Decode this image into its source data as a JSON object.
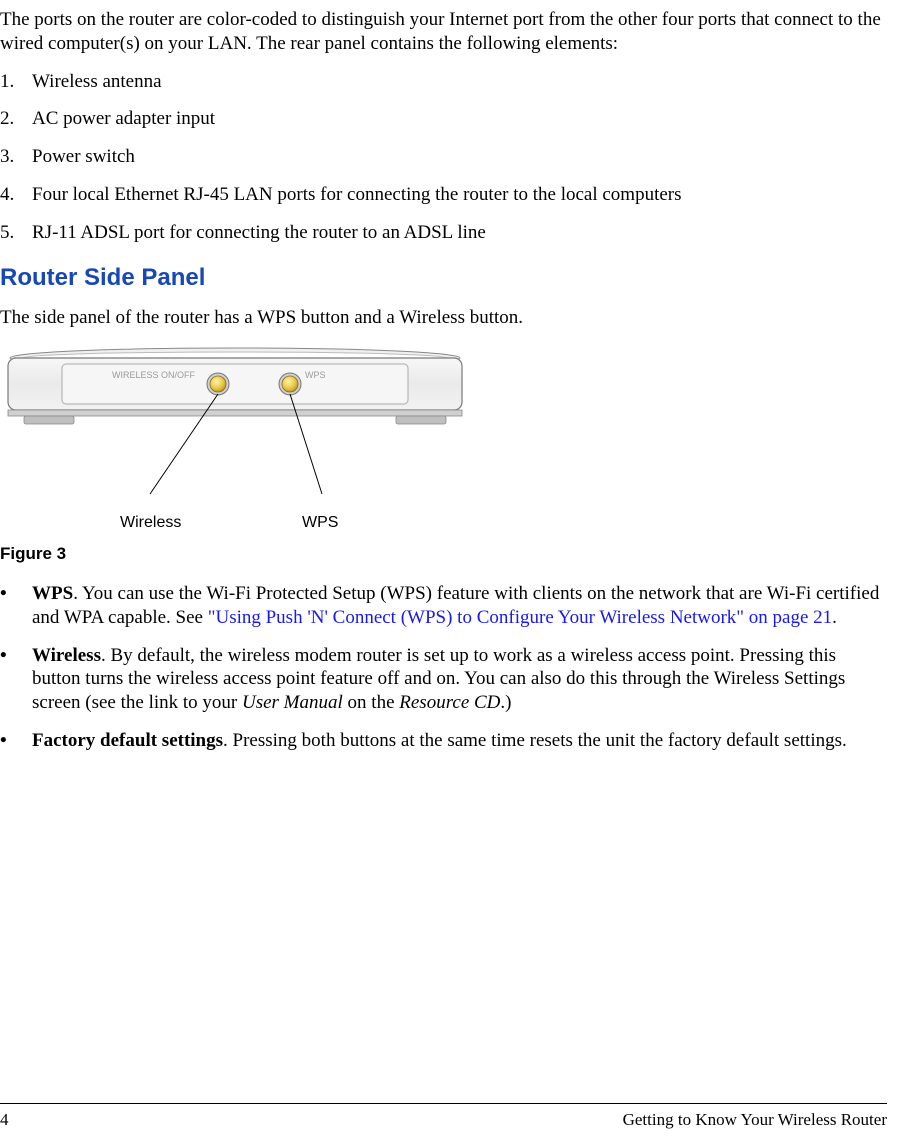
{
  "intro": "The ports on the router are color-coded to distinguish your Internet port from the other four ports that connect to the wired computer(s) on your LAN. The rear panel contains the following elements:",
  "list": {
    "n1": "1.",
    "i1": "Wireless antenna",
    "n2": "2.",
    "i2": "AC power adapter input",
    "n3": "3.",
    "i3": "Power switch",
    "n4": "4.",
    "i4": "Four local Ethernet RJ-45 LAN ports for connecting the router to the local computers",
    "n5": "5.",
    "i5": "RJ-11 ADSL port for connecting the router to an ADSL line"
  },
  "heading": "Router Side Panel",
  "side_panel_intro": "The side panel of the router has a WPS button and a Wireless button.",
  "figure": {
    "label_wireless_onoff": "WIRELESS ON/OFF",
    "label_wps_small": "WPS",
    "callout_wireless": "Wireless",
    "callout_wps": "WPS",
    "caption": "Figure 3"
  },
  "bullets": {
    "dot": "•",
    "wps_bold": "WPS",
    "wps_text_a": ". You can use the Wi-Fi Protected Setup (WPS) feature with clients on the network that are Wi-Fi certified and WPA capable. See ",
    "wps_link": "\"Using Push 'N' Connect (WPS) to Configure Your Wireless Network\" on page 21",
    "wps_text_b": ".",
    "wireless_bold": "Wireless",
    "wireless_text_a": ". By default, the wireless modem router is set up to work as a wireless access point. Pressing this button turns the wireless access point feature off and on. You can also do this through the Wireless Settings screen (see the link to your ",
    "wireless_italic1": "User Manual",
    "wireless_text_b": " on the ",
    "wireless_italic2": "Resource CD",
    "wireless_text_c": ".)",
    "factory_bold": "Factory default settings",
    "factory_text": ". Pressing both buttons at the same time resets the unit the factory default settings."
  },
  "footer": {
    "page": "4",
    "chapter": "Getting to Know Your Wireless Router"
  }
}
